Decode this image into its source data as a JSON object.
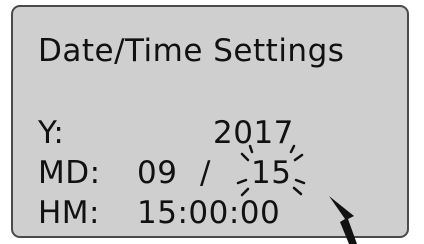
{
  "screen": {
    "title": "Date/Time Settings",
    "year_label": "Y:",
    "year_value": "2017",
    "md_label": "MD:",
    "month_value": "09",
    "separator": "/",
    "day_value": "15",
    "hm_label": "HM:",
    "time_value": "15:00:00"
  },
  "icons": {
    "blink_indicator": "blink-rays-icon",
    "cursor": "arrow-pointer-icon"
  },
  "colors": {
    "lcd_background": "#cfcfcf",
    "lcd_border": "#4a4a4a",
    "text": "#111111"
  }
}
